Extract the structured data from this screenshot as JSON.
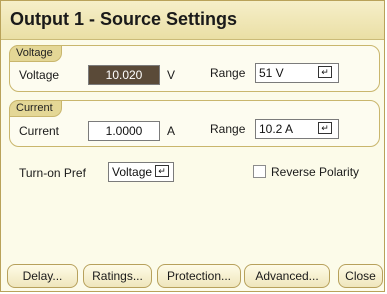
{
  "window": {
    "title": "Output 1 - Source Settings"
  },
  "voltage_group": {
    "legend": "Voltage",
    "label": "Voltage",
    "value": "10.020",
    "unit": "V",
    "range_label": "Range",
    "range_value": "51 V",
    "enter_icon": "enter-icon"
  },
  "current_group": {
    "legend": "Current",
    "label": "Current",
    "value": "1.0000",
    "unit": "A",
    "range_label": "Range",
    "range_value": "10.2 A",
    "enter_icon": "enter-icon"
  },
  "turn_on": {
    "label": "Turn-on Pref",
    "value": "Voltage",
    "enter_icon": "enter-icon"
  },
  "reverse_polarity": {
    "label": "Reverse Polarity",
    "checked": false
  },
  "buttons": {
    "delay": "Delay...",
    "ratings": "Ratings...",
    "protection": "Protection...",
    "advanced": "Advanced...",
    "close": "Close"
  },
  "colors": {
    "title_bar": "#eadfa5",
    "group_tag": "#e4d796",
    "active_field": "#5a4a38",
    "border": "#c9b66d"
  }
}
